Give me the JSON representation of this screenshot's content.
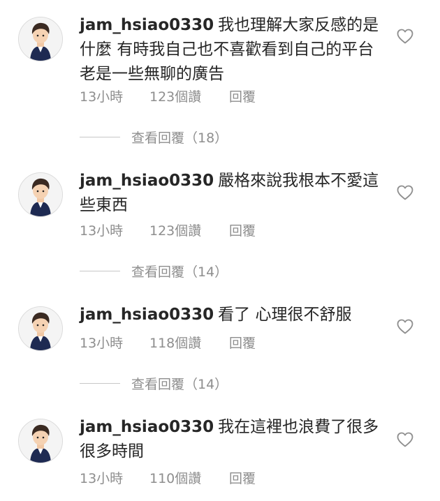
{
  "comments": [
    {
      "username": "jam_hsiao0330",
      "text": "我也理解大家反感的是什麼 有時我自己也不喜歡看到自己的平台老是一些無聊的廣告",
      "time": "13小時",
      "likes": "123個讚",
      "reply_label": "回覆",
      "view_replies": "查看回覆（18）"
    },
    {
      "username": "jam_hsiao0330",
      "text": "嚴格來說我根本不愛這些東西",
      "time": "13小時",
      "likes": "123個讚",
      "reply_label": "回覆",
      "view_replies": "查看回覆（14）"
    },
    {
      "username": "jam_hsiao0330",
      "text": "看了 心理很不舒服",
      "time": "13小時",
      "likes": "118個讚",
      "reply_label": "回覆",
      "view_replies": "查看回覆（14）"
    },
    {
      "username": "jam_hsiao0330",
      "text": "我在這裡也浪費了很多很多時間",
      "time": "13小時",
      "likes": "110個讚",
      "reply_label": "回覆"
    }
  ],
  "icons": {
    "like": "heart-outline-icon",
    "avatar": "user-avatar"
  },
  "colors": {
    "text": "#262626",
    "muted": "#8e8e8e",
    "divider": "#c7c7c7"
  }
}
